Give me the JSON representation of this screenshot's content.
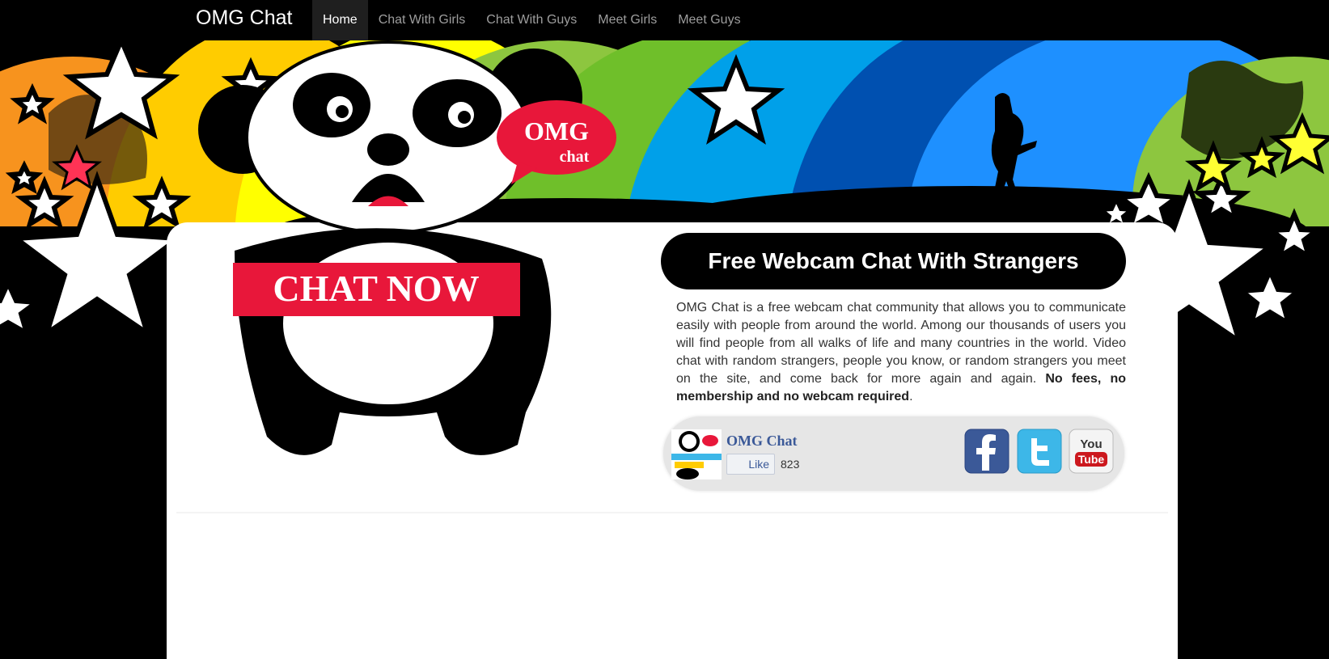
{
  "navbar": {
    "brand": "OMG Chat",
    "items": [
      {
        "label": "Home",
        "active": true
      },
      {
        "label": "Chat With Girls"
      },
      {
        "label": "Chat With Guys"
      },
      {
        "label": "Meet Girls"
      },
      {
        "label": "Meet Guys"
      }
    ]
  },
  "hero": {
    "logo_line1": "OMG",
    "logo_line2": "chat",
    "cta": "CHAT NOW"
  },
  "content": {
    "headline": "Free Webcam Chat With Strangers",
    "description": "OMG Chat is a free webcam chat community that allows you to communicate easily with people from around the world. Among our thousands of users you will find people from all walks of life and many countries in the world. Video chat with random strangers, people you know, or random strangers you meet on the site, and come back for more again and again.",
    "description_bold": "No fees, no membership and no webcam required",
    "description_end": "."
  },
  "social": {
    "page_name": "OMG Chat",
    "like_label": "Like",
    "like_count": "823",
    "icons": [
      "facebook-icon",
      "twitter-icon",
      "youtube-icon"
    ],
    "youtube_you": "You",
    "youtube_tube": "Tube"
  },
  "colors": {
    "accent_red": "#e8173a",
    "facebook_blue": "#3b5998",
    "twitter_blue": "#3db7e8"
  }
}
